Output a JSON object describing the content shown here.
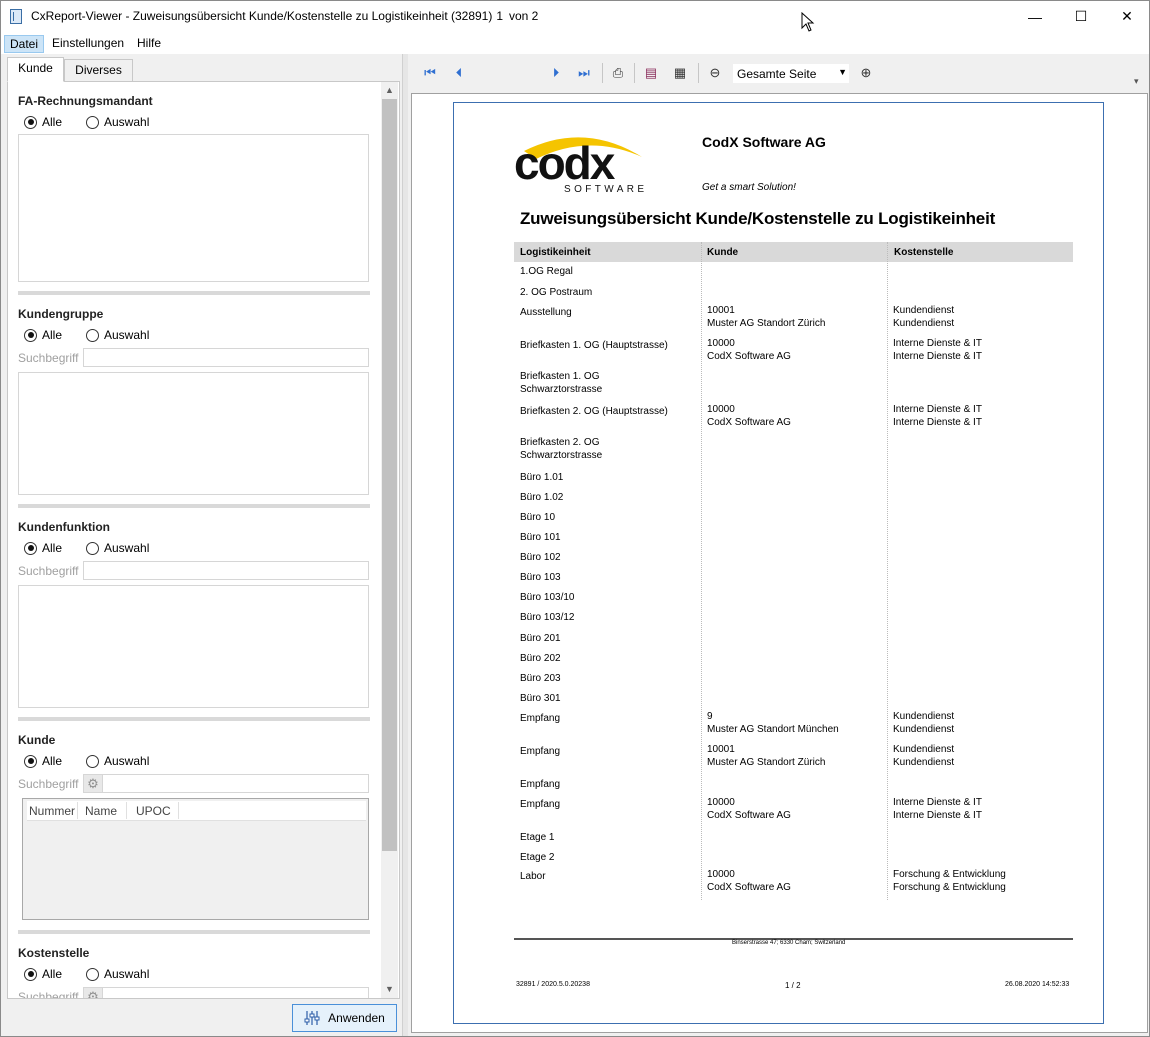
{
  "window": {
    "title": "CxReport-Viewer - Zuweisungsübersicht Kunde/Kostenstelle zu Logistikeinheit (32891)",
    "minimize": "—",
    "maximize": "☐",
    "close": "✕"
  },
  "menu": {
    "items": [
      "Datei",
      "Einstellungen",
      "Hilfe"
    ]
  },
  "tabs": [
    "Kunde",
    "Diverses"
  ],
  "filters": {
    "fa": {
      "title": "FA-Rechnungsmandant",
      "all": "Alle",
      "select": "Auswahl"
    },
    "kundengruppe": {
      "title": "Kundengruppe",
      "all": "Alle",
      "select": "Auswahl",
      "search_label": "Suchbegriff"
    },
    "kundenfunktion": {
      "title": "Kundenfunktion",
      "all": "Alle",
      "select": "Auswahl",
      "search_label": "Suchbegriff"
    },
    "kunde": {
      "title": "Kunde",
      "all": "Alle",
      "select": "Auswahl",
      "search_label": "Suchbegriff",
      "columns": [
        "Nummer",
        "Name",
        "UPOC"
      ]
    },
    "kostenstelle": {
      "title": "Kostenstelle",
      "all": "Alle",
      "select": "Auswahl",
      "search_label": "Suchbegriff"
    }
  },
  "apply_button": "Anwenden",
  "toolbar": {
    "page": "1",
    "of_pages": "von 2",
    "zoom": "Gesamte Seite"
  },
  "report": {
    "company": "CodX Software AG",
    "slogan": "Get a smart Solution!",
    "title": "Zuweisungsübersicht Kunde/Kostenstelle zu Logistikeinheit",
    "headers": [
      "Logistikeinheit",
      "Kunde",
      "Kostenstelle"
    ],
    "rows": [
      {
        "unit": "1.OG Regal",
        "kunde": "",
        "kunde2": "",
        "kst": "",
        "kst2": ""
      },
      {
        "unit": "2. OG Postraum",
        "kunde": "",
        "kunde2": "",
        "kst": "",
        "kst2": ""
      },
      {
        "unit": "Ausstellung",
        "kunde": "10001",
        "kunde2": "Muster AG Standort Zürich",
        "kst": "Kundendienst",
        "kst2": "Kundendienst"
      },
      {
        "unit": "Briefkasten 1. OG (Hauptstrasse)",
        "kunde": "10000",
        "kunde2": "CodX Software AG",
        "kst": "Interne Dienste & IT",
        "kst2": "Interne Dienste & IT"
      },
      {
        "unit": "Briefkasten 1. OG",
        "unit2": "Schwarztorstrasse",
        "kunde": "",
        "kunde2": "",
        "kst": "",
        "kst2": ""
      },
      {
        "unit": "Briefkasten 2. OG  (Hauptstrasse)",
        "kunde": "10000",
        "kunde2": "CodX Software AG",
        "kst": "Interne Dienste & IT",
        "kst2": "Interne Dienste & IT"
      },
      {
        "unit": "Briefkasten 2. OG",
        "unit2": "Schwarztorstrasse",
        "kunde": "",
        "kunde2": "",
        "kst": "",
        "kst2": ""
      },
      {
        "unit": "Büro 1.01"
      },
      {
        "unit": "Büro 1.02"
      },
      {
        "unit": "Büro 10"
      },
      {
        "unit": "Büro 101"
      },
      {
        "unit": "Büro 102"
      },
      {
        "unit": "Büro 103"
      },
      {
        "unit": "Büro 103/10"
      },
      {
        "unit": "Büro 103/12"
      },
      {
        "unit": "Büro 201"
      },
      {
        "unit": "Büro 202"
      },
      {
        "unit": "Büro 203"
      },
      {
        "unit": "Büro 301"
      },
      {
        "unit": "Empfang",
        "kunde": "9",
        "kunde2": "Muster AG Standort München",
        "kst": "Kundendienst",
        "kst2": "Kundendienst"
      },
      {
        "unit": "Empfang",
        "kunde": "10001",
        "kunde2": "Muster AG Standort Zürich",
        "kst": "Kundendienst",
        "kst2": "Kundendienst"
      },
      {
        "unit": "Empfang"
      },
      {
        "unit": "Empfang",
        "kunde": "10000",
        "kunde2": "CodX Software AG",
        "kst": "Interne Dienste & IT",
        "kst2": "Interne Dienste & IT"
      },
      {
        "unit": "Etage 1"
      },
      {
        "unit": "Etage 2"
      },
      {
        "unit": "Labor",
        "kunde": "10000",
        "kunde2": "CodX Software AG",
        "kst": "Forschung & Entwicklung",
        "kst2": "Forschung & Entwicklung"
      }
    ],
    "footer_address": "Binserstrasse 47; 6330 Cham; Switzerland",
    "footer_left": "32891 / 2020.5.0.20238",
    "footer_page": "1 / 2",
    "footer_date": "26.08.2020 14:52:33"
  },
  "colors": {
    "accent": "#3c6fb0",
    "logo_yellow": "#f5c400",
    "header_gray": "#d9d9d9"
  }
}
